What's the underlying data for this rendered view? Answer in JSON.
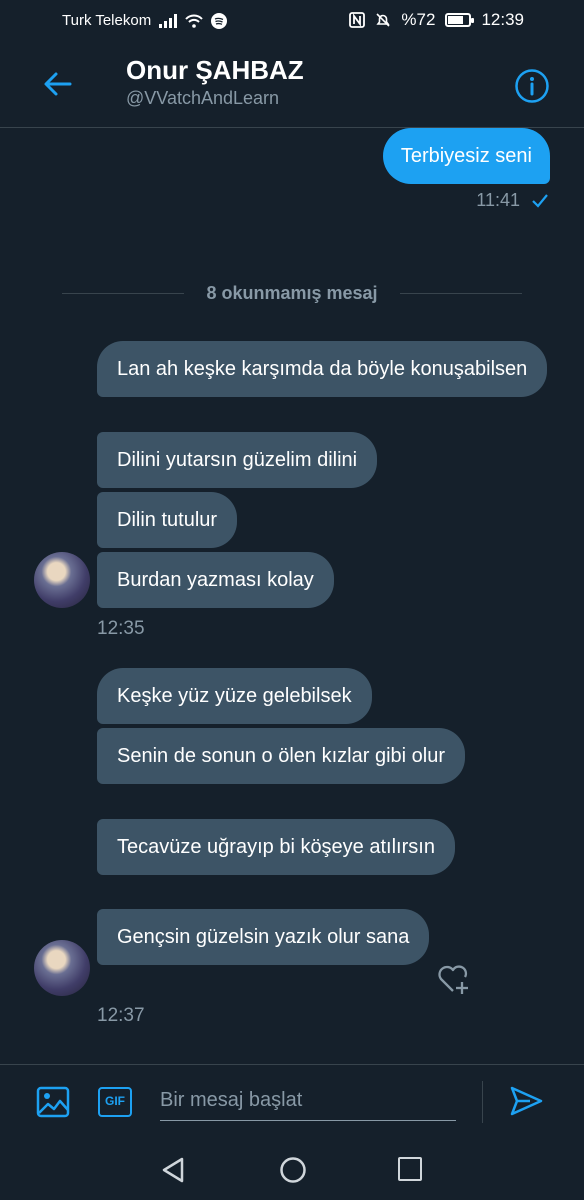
{
  "status": {
    "carrier": "Turk Telekom",
    "battery": "%72",
    "battery_level": 0.72,
    "time": "12:39"
  },
  "header": {
    "name": "Onur ŞAHBAZ",
    "handle": "@VVatchAndLearn"
  },
  "sent": {
    "text": "Terbiyesiz seni",
    "time": "11:41",
    "status_icon": "check-icon"
  },
  "divider": {
    "text": "8 okunmamış mesaj"
  },
  "groups": [
    {
      "messages": [
        "Lan ah keşke karşımda da böyle konuşabilsen",
        "Dilini yutarsın güzelim dilini",
        "Dilin tutulur",
        "Burdan yazması kolay"
      ],
      "time": "12:35"
    },
    {
      "messages": [
        "Keşke yüz yüze gelebilsek",
        "Senin de sonun o ölen kızlar gibi olur",
        "Tecavüze uğrayıp bi köşeye atılırsın",
        "Gençsin güzelsin yazık olur sana"
      ],
      "time": "12:37"
    }
  ],
  "composer": {
    "placeholder": "Bir mesaj başlat",
    "gif_label": "GIF"
  },
  "colors": {
    "background": "#15202b",
    "accent": "#1da1f2",
    "bubble": "#3d5466",
    "muted": "#8899a6"
  }
}
